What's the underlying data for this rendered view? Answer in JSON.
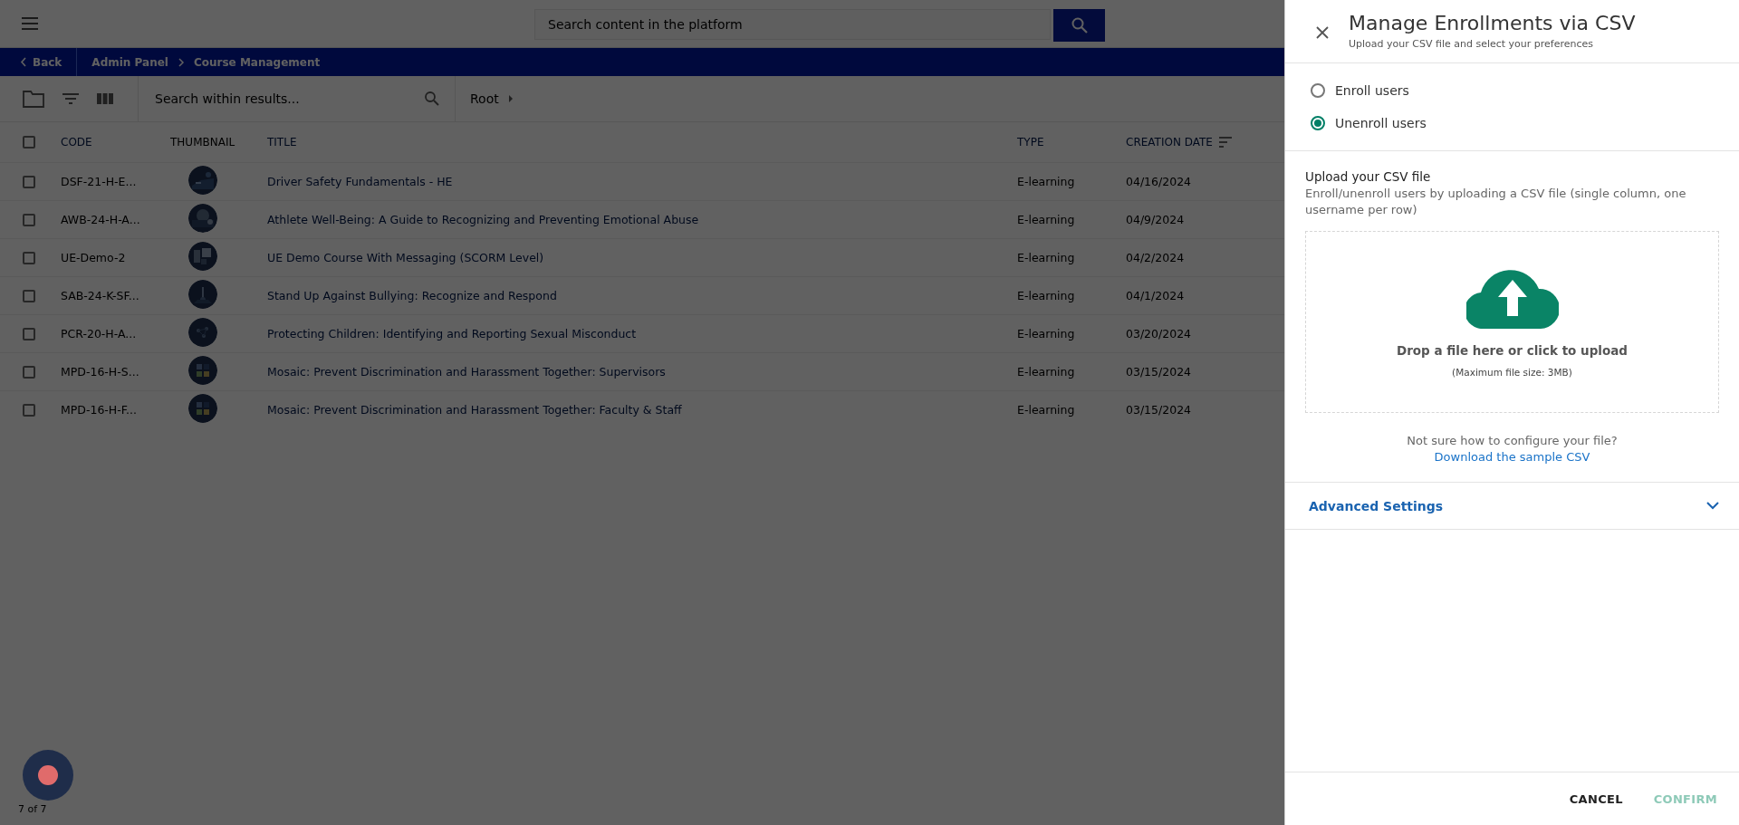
{
  "top_bar": {
    "search": {
      "placeholder": "Search content in the platform"
    }
  },
  "breadcrumb": {
    "back": "Back",
    "items": [
      "Admin Panel",
      "Course Management"
    ]
  },
  "toolbar": {
    "search": {
      "placeholder": "Search within results..."
    },
    "folder": "Root"
  },
  "table": {
    "header_checked": false,
    "columns": [
      {
        "label": "CODE",
        "sortable": true,
        "sorted": false
      },
      {
        "label": "THUMBNAIL",
        "sortable": false,
        "sorted": false
      },
      {
        "label": "TITLE",
        "sortable": true,
        "sorted": false
      },
      {
        "label": "TYPE",
        "sortable": true,
        "sorted": false
      },
      {
        "label": "CREATION DATE",
        "sortable": true,
        "sorted": true
      }
    ],
    "rows": [
      {
        "code": "DSF-21-H-E...",
        "title": "Driver Safety Fundamentals - HE",
        "type": "E-learning",
        "date": "04/16/2024",
        "checked": false
      },
      {
        "code": "AWB-24-H-A...",
        "title": "Athlete Well-Being: A Guide to Recognizing and Preventing Emotional Abuse",
        "type": "E-learning",
        "date": "04/9/2024",
        "checked": false
      },
      {
        "code": "UE-Demo-2",
        "title": "UE Demo Course With Messaging (SCORM Level)",
        "type": "E-learning",
        "date": "04/2/2024",
        "checked": false
      },
      {
        "code": "SAB-24-K-SF...",
        "title": "Stand Up Against Bullying: Recognize and Respond",
        "type": "E-learning",
        "date": "04/1/2024",
        "checked": false
      },
      {
        "code": "PCR-20-H-A...",
        "title": "Protecting Children: Identifying and Reporting Sexual Misconduct",
        "type": "E-learning",
        "date": "03/20/2024",
        "checked": false
      },
      {
        "code": "MPD-16-H-S...",
        "title": "Mosaic: Prevent Discrimination and Harassment Together: Supervisors",
        "type": "E-learning",
        "date": "03/15/2024",
        "checked": false
      },
      {
        "code": "MPD-16-H-F...",
        "title": "Mosaic: Prevent Discrimination and Harassment Together: Faculty & Staff",
        "type": "E-learning",
        "date": "03/15/2024",
        "checked": false
      }
    ]
  },
  "pagination": "7 of 7",
  "panel": {
    "title": "Manage Enrollments via CSV",
    "subtitle": "Upload your CSV file and select your preferences",
    "options": [
      {
        "label": "Enroll users",
        "selected": false
      },
      {
        "label": "Unenroll users",
        "selected": true
      }
    ],
    "upload": {
      "heading": "Upload your CSV file",
      "description": "Enroll/unenroll users by uploading a CSV file (single column, one username per row)",
      "drop_text": "Drop a file here or click to upload",
      "limit": "(Maximum file size: 3MB)"
    },
    "help": "Not sure how to configure your file?",
    "link": "Download the sample CSV",
    "advanced": {
      "label": "Advanced Settings",
      "expanded": false
    },
    "buttons": [
      {
        "label": "CANCEL",
        "kind": "cancel",
        "disabled": false
      },
      {
        "label": "CONFIRM",
        "kind": "confirm",
        "disabled": true
      }
    ]
  }
}
